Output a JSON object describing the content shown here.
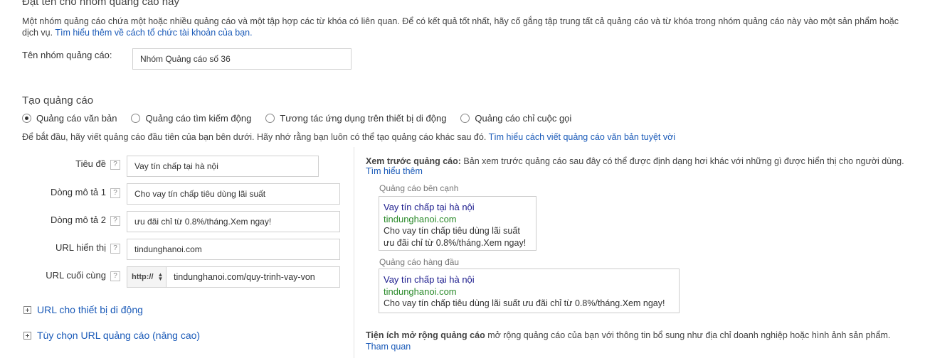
{
  "adgroup": {
    "heading": "Đặt tên cho nhóm quảng cáo này",
    "description": "Một nhóm quảng cáo chứa một hoặc nhiều quảng cáo và một tập hợp các từ khóa có liên quan. Để có kết quả tốt nhất, hãy cố gắng tập trung tất cả quảng cáo và từ khóa trong nhóm quảng cáo này vào một sản phẩm hoặc",
    "description_line2_prefix": "dịch vụ.",
    "learn_more_link": "Tìm hiểu thêm về cách tổ chức tài khoản của bạn.",
    "name_label": "Tên nhóm quảng cáo:",
    "name_value": "Nhóm Quảng cáo số 36"
  },
  "create_ad": {
    "heading": "Tạo quảng cáo",
    "ad_types": [
      {
        "label": "Quảng cáo văn bản",
        "checked": true
      },
      {
        "label": "Quảng cáo tìm kiếm động",
        "checked": false
      },
      {
        "label": "Tương tác ứng dụng trên thiết bị di động",
        "checked": false
      },
      {
        "label": "Quảng cáo chỉ cuộc gọi",
        "checked": false
      }
    ],
    "intro": "Để bắt đầu, hãy viết quảng cáo đầu tiên của bạn bên dưới. Hãy nhớ rằng bạn luôn có thể tạo quảng cáo khác sau đó.",
    "intro_link": "Tìm hiểu cách viết quảng cáo văn bản tuyệt vời"
  },
  "form": {
    "help_icon": "?",
    "headline_label": "Tiêu đề",
    "headline_value": "Vay tín chấp tại hà nội",
    "desc1_label": "Dòng mô tả 1",
    "desc1_value": "Cho vay tín chấp tiêu dùng lãi suất",
    "desc2_label": "Dòng mô tả 2",
    "desc2_value": "ưu đãi chỉ từ 0.8%/tháng.Xem ngay!",
    "display_url_label": "URL hiển thị",
    "display_url_value": "tindunghanoi.com",
    "final_url_label": "URL cuối cùng",
    "final_url_protocol": "http://",
    "final_url_value": "tindunghanoi.com/quy-trinh-vay-von",
    "mobile_url_toggle": "URL cho thiết bị di động",
    "advanced_url_toggle": "Tùy chọn URL quảng cáo (nâng cao)"
  },
  "preview": {
    "title_bold": "Xem trước quảng cáo:",
    "title_rest": "Bản xem trước quảng cáo sau đây có thể được định dạng hơi khác với những gì được hiển thị cho người dùng.",
    "learn_more": "Tìm hiểu thêm",
    "side_label": "Quảng cáo bên cạnh",
    "side": {
      "title": "Vay tín chấp tại hà nội",
      "url": "tindunghanoi.com",
      "line1": "Cho vay tín chấp tiêu dùng lãi suất",
      "line2": "ưu đãi chỉ từ 0.8%/tháng.Xem ngay!"
    },
    "top_label": "Quảng cáo hàng đầu",
    "top": {
      "title": "Vay tín chấp tại hà nội",
      "url": "tindunghanoi.com",
      "line1": "Cho vay tín chấp tiêu dùng lãi suất ưu đãi chỉ từ 0.8%/tháng.Xem ngay!"
    }
  },
  "extensions": {
    "title_bold": "Tiện ích mở rộng quảng cáo",
    "title_rest": "mở rộng quảng cáo của bạn với thông tin bổ sung như địa chỉ doanh nghiệp hoặc hình ảnh sản phẩm.",
    "link": "Tham quan"
  }
}
